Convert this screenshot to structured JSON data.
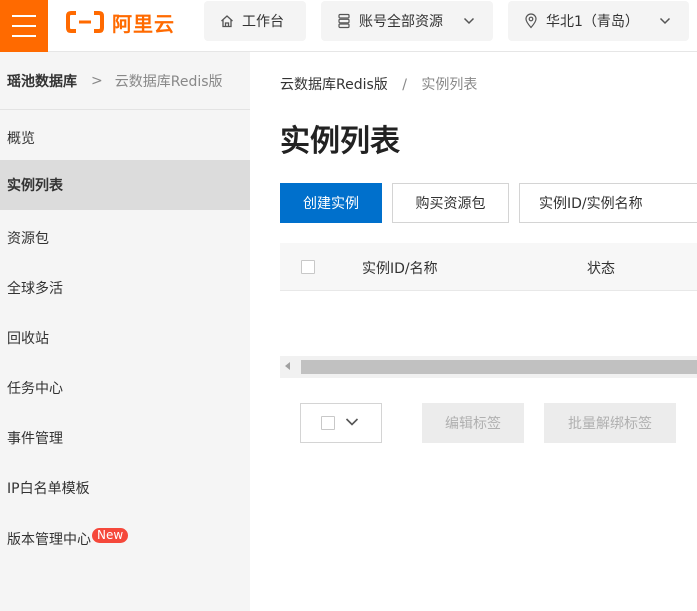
{
  "topbar": {
    "logo_text": "阿里云",
    "workbench_label": "工作台",
    "resources_label": "账号全部资源",
    "region_label": "华北1（青岛）"
  },
  "colors": {
    "brand": "#ff6a00",
    "primary": "#0070cc",
    "badge": "#f5483b",
    "sidebar_bg": "#f5f5f5",
    "sidebar_active": "#dcdcdc"
  },
  "sidebar": {
    "header": {
      "root": "瑶池数据库",
      "separator": ">",
      "current": "云数据库Redis版"
    },
    "items": [
      {
        "label": "概览",
        "active": false
      },
      {
        "label": "实例列表",
        "active": true
      },
      {
        "label": "资源包",
        "active": false
      },
      {
        "label": "全球多活",
        "active": false
      },
      {
        "label": "回收站",
        "active": false
      },
      {
        "label": "任务中心",
        "active": false
      },
      {
        "label": "事件管理",
        "active": false
      },
      {
        "label": "IP白名单模板",
        "active": false
      },
      {
        "label": "版本管理中心",
        "active": false,
        "badge": "New"
      }
    ]
  },
  "main": {
    "breadcrumb": {
      "parent": "云数据库Redis版",
      "separator": "/",
      "current": "实例列表"
    },
    "title": "实例列表",
    "toolbar": {
      "create_label": "创建实例",
      "buy_label": "购买资源包",
      "search_filter_label": "实例ID/实例名称"
    },
    "table": {
      "columns": [
        "实例ID/名称",
        "状态"
      ]
    },
    "batch": {
      "edit_tags_label": "编辑标签",
      "unbind_tags_label": "批量解绑标签"
    }
  }
}
